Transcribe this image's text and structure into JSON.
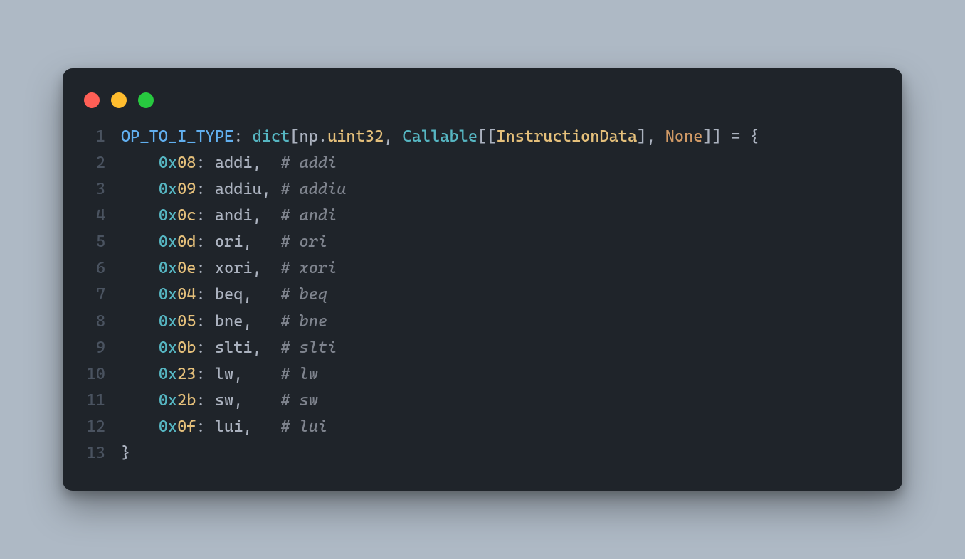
{
  "colors": {
    "window_bg": "#1f242a",
    "page_bg": "#aeb9c5",
    "traffic_red": "#ff5f56",
    "traffic_yellow": "#ffbd2e",
    "traffic_green": "#27c93f"
  },
  "line_numbers": [
    "1",
    "2",
    "3",
    "4",
    "5",
    "6",
    "7",
    "8",
    "9",
    "10",
    "11",
    "12",
    "13"
  ],
  "line1": {
    "name": "OP_TO_I_TYPE",
    "colon": ": ",
    "dict_kw": "dict",
    "lbrack1": "[",
    "np": "np",
    "dot": ".",
    "uint32": "uint32",
    "comma1": ", ",
    "callable": "Callable",
    "lbrack2": "[[",
    "instr": "InstructionData",
    "rbrack2": "]",
    "comma2": ", ",
    "none": "None",
    "rbrack3": "]] ",
    "equals": "=",
    "space_brace": " {"
  },
  "entries": [
    {
      "indent": "    ",
      "hex_pre": "0x",
      "hex_num": "08",
      "colon": ": ",
      "ident": "addi",
      "comma_pad": ",  ",
      "comment": "# addi"
    },
    {
      "indent": "    ",
      "hex_pre": "0x",
      "hex_num": "09",
      "colon": ": ",
      "ident": "addiu",
      "comma_pad": ", ",
      "comment": "# addiu"
    },
    {
      "indent": "    ",
      "hex_pre": "0x",
      "hex_num": "0c",
      "colon": ": ",
      "ident": "andi",
      "comma_pad": ",  ",
      "comment": "# andi"
    },
    {
      "indent": "    ",
      "hex_pre": "0x",
      "hex_num": "0d",
      "colon": ": ",
      "ident": "ori",
      "comma_pad": ",   ",
      "comment": "# ori"
    },
    {
      "indent": "    ",
      "hex_pre": "0x",
      "hex_num": "0e",
      "colon": ": ",
      "ident": "xori",
      "comma_pad": ",  ",
      "comment": "# xori"
    },
    {
      "indent": "    ",
      "hex_pre": "0x",
      "hex_num": "04",
      "colon": ": ",
      "ident": "beq",
      "comma_pad": ",   ",
      "comment": "# beq"
    },
    {
      "indent": "    ",
      "hex_pre": "0x",
      "hex_num": "05",
      "colon": ": ",
      "ident": "bne",
      "comma_pad": ",   ",
      "comment": "# bne"
    },
    {
      "indent": "    ",
      "hex_pre": "0x",
      "hex_num": "0b",
      "colon": ": ",
      "ident": "slti",
      "comma_pad": ",  ",
      "comment": "# slti"
    },
    {
      "indent": "    ",
      "hex_pre": "0x",
      "hex_num": "23",
      "colon": ": ",
      "ident": "lw",
      "comma_pad": ",    ",
      "comment": "# lw"
    },
    {
      "indent": "    ",
      "hex_pre": "0x",
      "hex_num": "2b",
      "colon": ": ",
      "ident": "sw",
      "comma_pad": ",    ",
      "comment": "# sw"
    },
    {
      "indent": "    ",
      "hex_pre": "0x",
      "hex_num": "0f",
      "colon": ": ",
      "ident": "lui",
      "comma_pad": ",   ",
      "comment": "# lui"
    }
  ],
  "close_brace": "}"
}
